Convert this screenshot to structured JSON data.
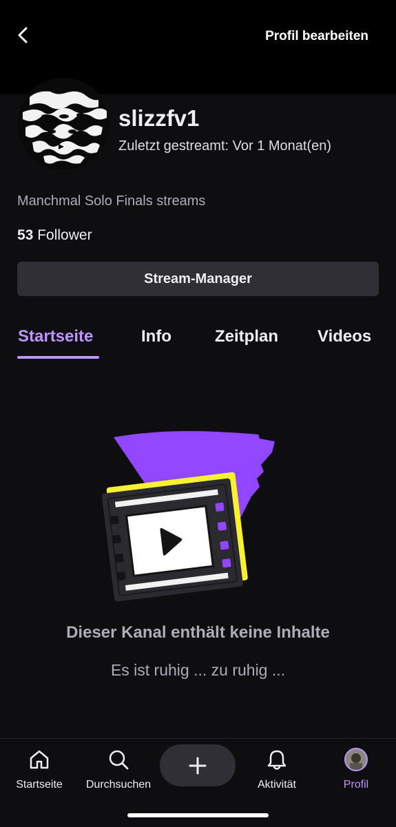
{
  "header": {
    "edit_profile": "Profil bearbeiten"
  },
  "profile": {
    "username": "slizzfv1",
    "last_streamed": "Zuletzt gestreamt: Vor 1 Monat(en)",
    "bio": "Manchmal Solo Finals streams",
    "follower_count": "53",
    "follower_label": "Follower"
  },
  "stream_manager_label": "Stream-Manager",
  "tabs": [
    {
      "label": "Startseite",
      "active": true
    },
    {
      "label": "Info"
    },
    {
      "label": "Zeitplan"
    },
    {
      "label": "Videos"
    }
  ],
  "empty_state": {
    "title": "Dieser Kanal enthält keine Inhalte",
    "subtitle": "Es ist ruhig ... zu ruhig ..."
  },
  "bottom_nav": [
    {
      "label": "Startseite",
      "icon": "home-icon"
    },
    {
      "label": "Durchsuchen",
      "icon": "search-icon"
    },
    {
      "label": "",
      "icon": "plus-icon"
    },
    {
      "label": "Aktivität",
      "icon": "bell-icon"
    },
    {
      "label": "Profil",
      "icon": "profile-avatar",
      "active": true
    }
  ],
  "colors": {
    "accent": "#bf94ff",
    "background": "#0e0e10",
    "button": "#2f2f35",
    "illustration_purple": "#9147ff",
    "illustration_yellow": "#f8f131"
  }
}
